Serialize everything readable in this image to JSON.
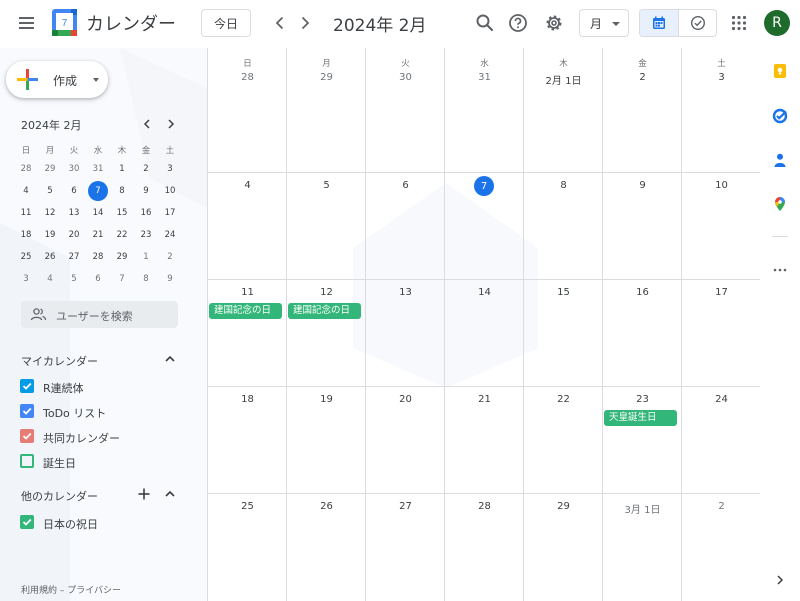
{
  "header": {
    "app_title": "カレンダー",
    "logo_day": "7",
    "today_label": "今日",
    "current_month": "2024年 2月",
    "view_mode": "月",
    "avatar_initial": "R"
  },
  "colors": {
    "accent": "#1a73e8",
    "holiday": "#33b679",
    "avatar": "#1e6b2c",
    "calendar_r": "#039be5",
    "calendar_todo": "#4285f4",
    "calendar_shared": "#e67c73",
    "calendar_birthday": "#33b679",
    "calendar_japan": "#33b679"
  },
  "sidebar": {
    "create_label": "作成",
    "mini_title": "2024年 2月",
    "weekdays": [
      "日",
      "月",
      "火",
      "水",
      "木",
      "金",
      "土"
    ],
    "weeks": [
      [
        "28",
        "29",
        "30",
        "31",
        "1",
        "2",
        "3"
      ],
      [
        "4",
        "5",
        "6",
        "7",
        "8",
        "9",
        "10"
      ],
      [
        "11",
        "12",
        "13",
        "14",
        "15",
        "16",
        "17"
      ],
      [
        "18",
        "19",
        "20",
        "21",
        "22",
        "23",
        "24"
      ],
      [
        "25",
        "26",
        "27",
        "28",
        "29",
        "1",
        "2"
      ],
      [
        "3",
        "4",
        "5",
        "6",
        "7",
        "8",
        "9"
      ]
    ],
    "search_people": "ユーザーを検索",
    "my_calendars_title": "マイカレンダー",
    "my_calendars": [
      {
        "label": "R連続体",
        "checked": true
      },
      {
        "label": "ToDo リスト",
        "checked": true
      },
      {
        "label": "共同カレンダー",
        "checked": true
      },
      {
        "label": "誕生日",
        "checked": false
      }
    ],
    "other_calendars_title": "他のカレンダー",
    "other_calendars": [
      {
        "label": "日本の祝日",
        "checked": true
      }
    ],
    "footer_links": "利用規約 – プライバシー"
  },
  "main": {
    "weekdays": [
      "日",
      "月",
      "火",
      "水",
      "木",
      "金",
      "土"
    ],
    "weeks": [
      [
        "28",
        "29",
        "30",
        "31",
        "2月 1日",
        "2",
        "3"
      ],
      [
        "4",
        "5",
        "6",
        "7",
        "8",
        "9",
        "10"
      ],
      [
        "11",
        "12",
        "13",
        "14",
        "15",
        "16",
        "17"
      ],
      [
        "18",
        "19",
        "20",
        "21",
        "22",
        "23",
        "24"
      ],
      [
        "25",
        "26",
        "27",
        "28",
        "29",
        "3月 1日",
        "2"
      ]
    ],
    "events": [
      {
        "label": "建国記念の日",
        "week": 2,
        "day": 0
      },
      {
        "label": "建国記念の日",
        "week": 2,
        "day": 1
      },
      {
        "label": "天皇誕生日",
        "week": 3,
        "day": 5
      }
    ]
  }
}
